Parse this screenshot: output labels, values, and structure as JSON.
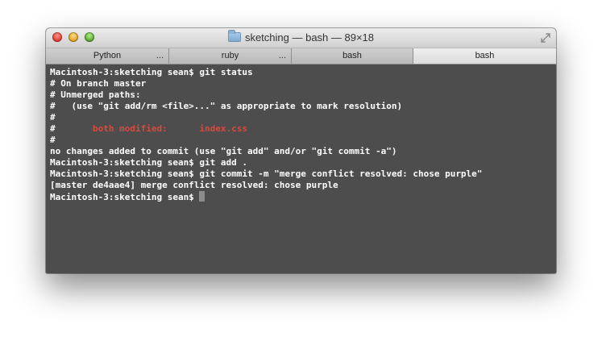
{
  "window": {
    "title": "sketching — bash — 89×18",
    "buttons": {
      "close": "close-button",
      "minimize": "minimize-button",
      "zoom": "zoom-button"
    },
    "icons": {
      "folder": "folder-icon",
      "fullscreen": "fullscreen-icon"
    }
  },
  "tabs": [
    {
      "label": "Python",
      "more": "..."
    },
    {
      "label": "ruby",
      "more": "..."
    },
    {
      "label": "bash",
      "more": ""
    },
    {
      "label": "bash",
      "more": "",
      "active": true
    }
  ],
  "terminal": {
    "lines": [
      "Macintosh-3:sketching sean$ git status",
      "# On branch master",
      "# Unmerged paths:",
      "#   (use \"git add/rm <file>...\" as appropriate to mark resolution)",
      "#",
      {
        "prefix": "#       ",
        "highlight": "both modified:      index.css"
      },
      "#",
      "no changes added to commit (use \"git add\" and/or \"git commit -a\")",
      "Macintosh-3:sketching sean$ git add .",
      "Macintosh-3:sketching sean$ git commit -m \"merge conflict resolved: chose purple\"",
      "[master de4aae4] merge conflict resolved: chose purple",
      "Macintosh-3:sketching sean$ "
    ],
    "colors": {
      "background": "#4d4d4d",
      "text": "#ffffff",
      "conflict": "#d84a3c",
      "cursor": "#8c8c8c"
    }
  }
}
